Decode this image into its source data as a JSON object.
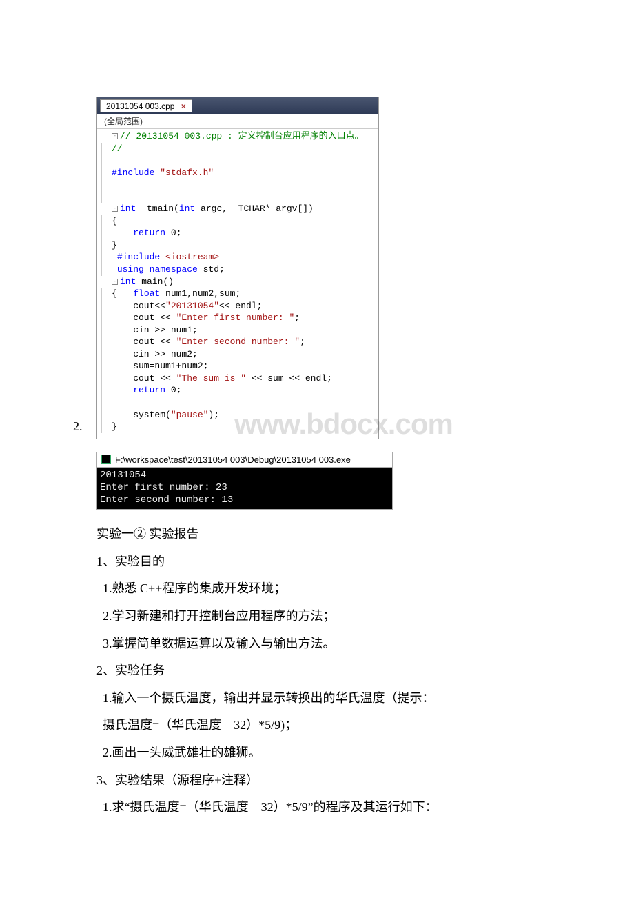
{
  "ide": {
    "tab_label": "20131054 003.cpp",
    "scope_label": "(全局范围)",
    "code": {
      "l1a": "// 20131054 003.cpp : ",
      "l1b": "定义控制台应用程序的入口点。",
      "l2": "//",
      "l4a": "#include ",
      "l4b": "\"stdafx.h\"",
      "l7a": "int",
      "l7b": " _tmain(",
      "l7c": "int",
      "l7d": " argc, _TCHAR* argv[])",
      "l8": "{",
      "l9a": "    ",
      "l9b": "return",
      "l9c": " 0;",
      "l10": "}",
      "l11a": " ",
      "l11b": "#include ",
      "l11c": "<iostream>",
      "l12a": " ",
      "l12b": "using",
      "l12c": " ",
      "l12d": "namespace",
      "l12e": " std;",
      "l13a": "int",
      "l13b": " main()",
      "l14a": "{   ",
      "l14b": "float",
      "l14c": " num1,num2,sum;",
      "l15a": "    cout<<",
      "l15b": "\"20131054\"",
      "l15c": "<< endl;",
      "l16a": "    cout << ",
      "l16b": "\"Enter first number: \"",
      "l16c": ";",
      "l17": "    cin >> num1;",
      "l18a": "    cout << ",
      "l18b": "\"Enter second number: \"",
      "l18c": ";",
      "l19": "    cin >> num2;",
      "l20": "    sum=num1+num2;",
      "l21a": "    cout << ",
      "l21b": "\"The sum is \"",
      "l21c": " << sum << endl;",
      "l22a": "    ",
      "l22b": "return",
      "l22c": " 0;",
      "l24a": "    system(",
      "l24b": "\"pause\"",
      "l24c": ");",
      "l25": "}"
    }
  },
  "list_num": "2.",
  "watermark": "www.bdocx.com",
  "console": {
    "title": "F:\\workspace\\test\\20131054 003\\Debug\\20131054 003.exe",
    "line1": "20131054",
    "line2": "Enter first number: 23",
    "line3": "Enter second number: 13"
  },
  "text": {
    "t1": "实验一② 实验报告",
    "t2": "1、实验目的",
    "t3": "1.熟悉 C++程序的集成开发环境；",
    "t4": "2.学习新建和打开控制台应用程序的方法；",
    "t5": "3.掌握简单数据运算以及输入与输出方法。",
    "t6": "2、实验任务",
    "t7": "1.输入一个摄氏温度，输出并显示转换出的华氏温度（提示：",
    "t8": "摄氏温度=（华氏温度—32）*5/9)；",
    "t9": "2.画出一头威武雄壮的雄狮。",
    "t10": "3、实验结果（源程序+注释）",
    "t11": "1.求“摄氏温度=（华氏温度—32）*5/9”的程序及其运行如下："
  }
}
